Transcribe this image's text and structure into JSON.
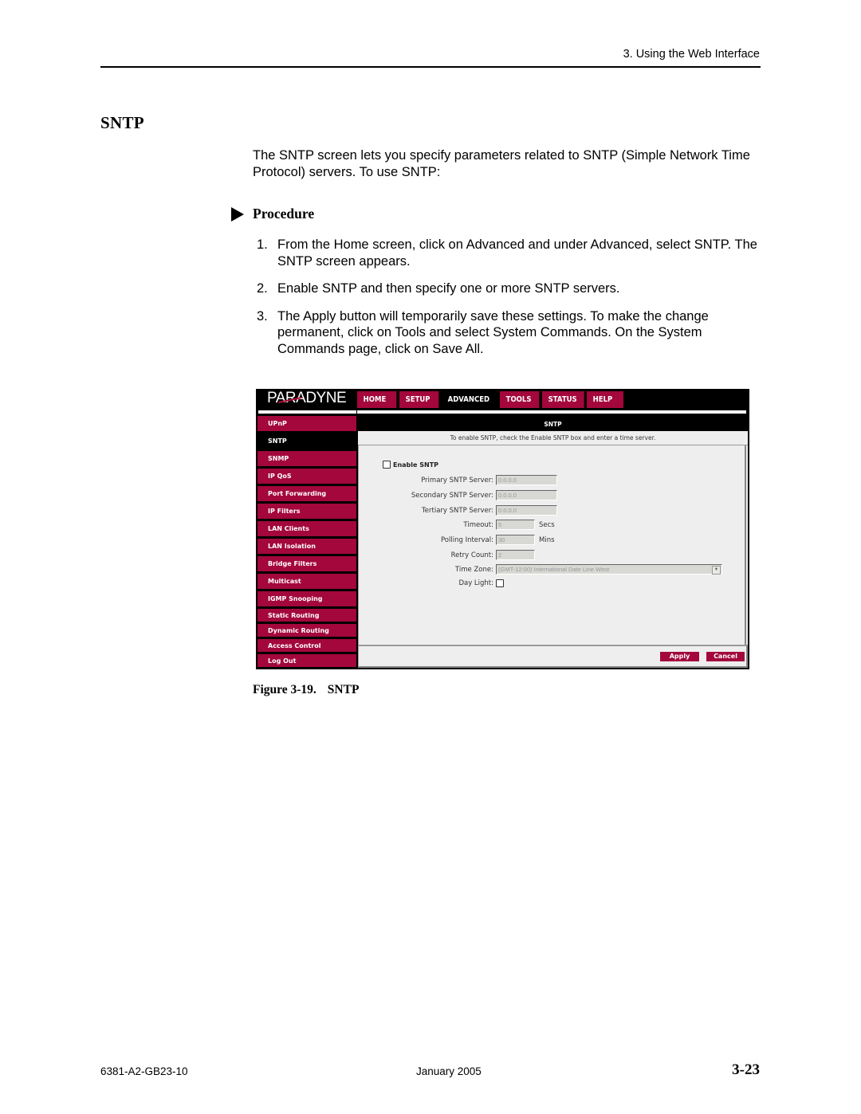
{
  "page": {
    "running_head": "3. Using the Web Interface",
    "section_title": "SNTP",
    "intro": "The SNTP screen lets you specify parameters related to SNTP (Simple Network Time Protocol) servers. To use SNTP:",
    "procedure_label": "Procedure",
    "procedure_icon": "triangle-right-icon",
    "steps": [
      {
        "num": "1.",
        "text": "From the Home screen, click on Advanced and under Advanced, select SNTP. The SNTP screen appears."
      },
      {
        "num": "2.",
        "text": "Enable SNTP and then specify one or more SNTP servers."
      },
      {
        "num": "3.",
        "text": "The Apply button will temporarily save these settings. To make the change permanent, click on Tools and select System Commands. On the System Commands page, click on Save All."
      }
    ],
    "figure_caption_number": "Figure 3-19.",
    "figure_caption_title": "SNTP",
    "footer": {
      "doc_number": "6381-A2-GB23-10",
      "date": "January 2005",
      "page_number": "3-23"
    }
  },
  "screenshot": {
    "logo": "PARADYNE",
    "brand_color": "#a3073c",
    "nav_tabs": [
      {
        "label": "HOME",
        "active": false
      },
      {
        "label": "SETUP",
        "active": false
      },
      {
        "label": "ADVANCED",
        "active": true
      },
      {
        "label": "TOOLS",
        "active": false
      },
      {
        "label": "STATUS",
        "active": false
      },
      {
        "label": "HELP",
        "active": false
      }
    ],
    "sidebar": [
      {
        "label": "UPnP",
        "active": false
      },
      {
        "label": "SNTP",
        "active": true
      },
      {
        "label": "SNMP",
        "active": false
      },
      {
        "label": "IP QoS",
        "active": false
      },
      {
        "label": "Port Forwarding",
        "active": false
      },
      {
        "label": "IP Filters",
        "active": false
      },
      {
        "label": "LAN Clients",
        "active": false
      },
      {
        "label": "LAN Isolation",
        "active": false
      },
      {
        "label": "Bridge Filters",
        "active": false
      },
      {
        "label": "Multicast",
        "active": false
      },
      {
        "label": "IGMP Snooping",
        "active": false
      },
      {
        "label": "Static Routing",
        "active": false
      },
      {
        "label": "Dynamic Routing",
        "active": false
      },
      {
        "label": "Access Control",
        "active": false
      },
      {
        "label": "Log Out",
        "active": false
      }
    ],
    "content_title": "SNTP",
    "content_hint": "To enable SNTP, check the Enable SNTP box and enter a time server.",
    "enable_label": "Enable SNTP",
    "enable_checked": false,
    "fields": {
      "primary": {
        "label": "Primary SNTP Server:",
        "value": "0.0.0.0"
      },
      "secondary": {
        "label": "Secondary SNTP Server:",
        "value": "0.0.0.0"
      },
      "tertiary": {
        "label": "Tertiary SNTP Server:",
        "value": "0.0.0.0"
      },
      "timeout": {
        "label": "Timeout:",
        "value": "5",
        "unit": "Secs"
      },
      "polling": {
        "label": "Polling Interval:",
        "value": "30",
        "unit": "Mins"
      },
      "retry": {
        "label": "Retry Count:",
        "value": "2"
      },
      "timezone": {
        "label": "Time Zone:",
        "value": "(GMT-12:00) International Date Line West"
      },
      "daylight": {
        "label": "Day Light:",
        "checked": false
      }
    },
    "buttons": {
      "apply": "Apply",
      "cancel": "Cancel"
    }
  }
}
